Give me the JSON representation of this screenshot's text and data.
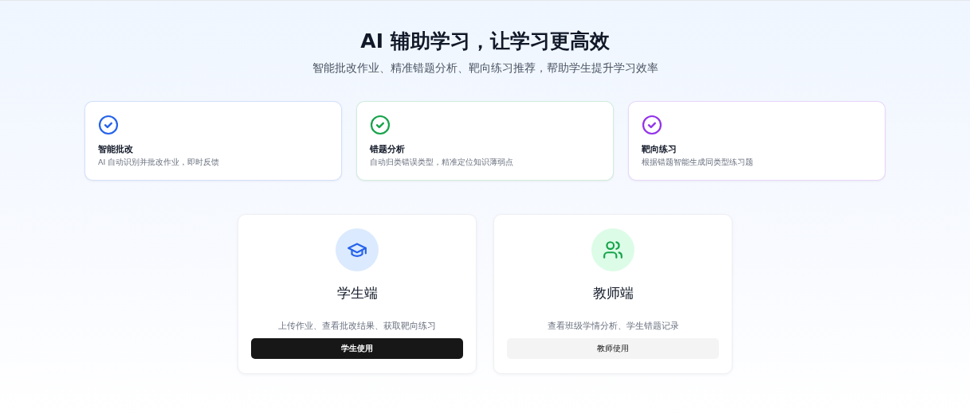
{
  "hero": {
    "title": "AI 辅助学习，让学习更高效",
    "subtitle": "智能批改作业、精准错题分析、靶向练习推荐，帮助学生提升学习效率"
  },
  "features": [
    {
      "title": "智能批改",
      "description": "AI 自动识别并批改作业，即时反馈",
      "color": "#2563eb"
    },
    {
      "title": "错题分析",
      "description": "自动归类错误类型，精准定位知识薄弱点",
      "color": "#16a34a"
    },
    {
      "title": "靶向练习",
      "description": "根据错题智能生成同类型练习题",
      "color": "#9333ea"
    }
  ],
  "roles": [
    {
      "kind": "student",
      "title": "学生端",
      "description": "上传作业、查看批改结果、获取靶向练习",
      "button": {
        "label": "学生使用",
        "kind": "primary"
      }
    },
    {
      "kind": "teacher",
      "title": "教师端",
      "description": "查看班级学情分析、学生错题记录",
      "button": {
        "label": "教师使用",
        "kind": "secondary"
      }
    }
  ]
}
